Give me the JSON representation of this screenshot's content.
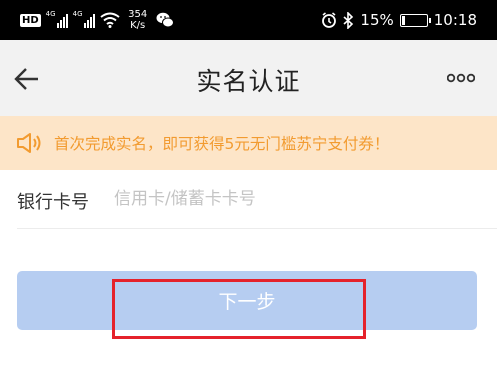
{
  "status_bar": {
    "hd_badge": "HD",
    "signal_1_label": "4G",
    "signal_2_label": "4G",
    "net_speed_value": "354",
    "net_speed_unit": "K/s",
    "battery_percent": "15%",
    "battery_level": 0.15,
    "time": "10:18",
    "icons": [
      "hd-icon",
      "signal-icon",
      "signal-icon",
      "wifi-icon",
      "wechat-icon",
      "alarm-icon",
      "bluetooth-icon",
      "battery-icon"
    ]
  },
  "header": {
    "back_icon": "arrow-left-icon",
    "title": "实名认证",
    "more_icon": "more-dots-icon"
  },
  "promo": {
    "icon": "speaker-icon",
    "text": "首次完成实名，即可获得5元无门槛苏宁支付券！",
    "text_color": "#f29b30",
    "background": "#fde5c8"
  },
  "card_field": {
    "label": "银行卡号",
    "placeholder": "信用卡/储蓄卡卡号",
    "value": ""
  },
  "next_button": {
    "label": "下一步",
    "color": "#b6cdf1"
  },
  "annotation_box_color": "#e5222b"
}
